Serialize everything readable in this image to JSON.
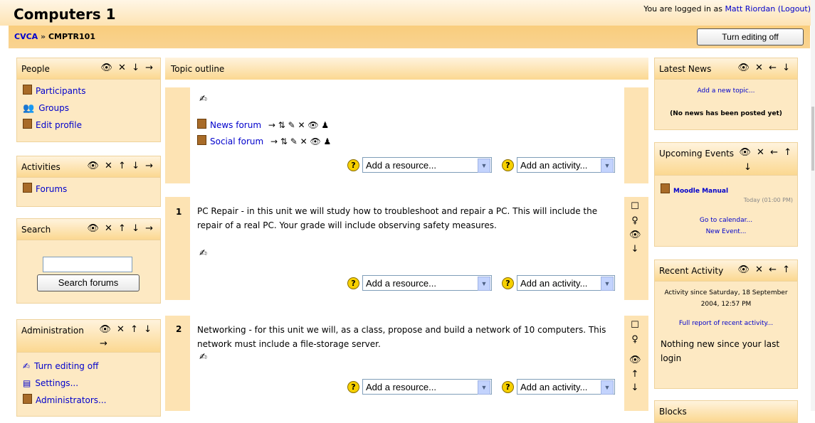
{
  "header": {
    "title": "Computers 1",
    "login_prefix": "You are logged in as",
    "login_user": "Matt Riordan",
    "logout": "(Logout)"
  },
  "navbar": {
    "crumb_home": "CVCA",
    "crumb_sep": "»",
    "crumb_course": "CMPTR101",
    "edit_button": "Turn editing off"
  },
  "left": {
    "people": {
      "title": "People",
      "icons": "👁 ✕ ↓ →",
      "items": [
        "Participants",
        "Groups",
        "Edit profile"
      ]
    },
    "activities": {
      "title": "Activities",
      "icons": "👁 ✕ ↑ ↓ →",
      "items": [
        "Forums"
      ]
    },
    "search": {
      "title": "Search",
      "icons": "👁 ✕ ↑ ↓ →",
      "button": "Search forums",
      "input_value": ""
    },
    "admin": {
      "title": "Administration",
      "icons": "👁 ✕ ↑ ↓",
      "icons2": "→",
      "items": [
        "Turn editing off",
        "Settings...",
        "Administrators..."
      ]
    }
  },
  "main": {
    "title": "Topic outline",
    "topic0": {
      "forums": [
        {
          "name": "News forum",
          "icons": "→ ⇅ ✎ ✕ 👁  ♟"
        },
        {
          "name": "Social forum",
          "icons": "→ ⇅ ✎ ✕ 👁  ♟"
        }
      ]
    },
    "topic1": {
      "number": "1",
      "text": "PC Repair - in this unit we will study how to troubleshoot and repair a PC. This will include the repair of a real PC. Your grade will include observing safety measures."
    },
    "topic2": {
      "number": "2",
      "text": "Networking - for this unit we will, as a class, propose and build a network of 10 computers. This network must include a file-storage server."
    },
    "add_resource": "Add a resource...",
    "add_activity": "Add an activity..."
  },
  "right": {
    "news": {
      "title": "Latest News",
      "icons": "👁 ✕ ← ↓",
      "add": "Add a new topic...",
      "empty": "(No news has been posted yet)"
    },
    "events": {
      "title": "Upcoming Events",
      "icons": "👁 ✕ ← ↑",
      "icons2": "↓",
      "event_name": "Moodle Manual",
      "event_time": "Today (01:00 PM)",
      "calendar": "Go to calendar...",
      "new_event": "New Event..."
    },
    "recent": {
      "title": "Recent Activity",
      "icons": "👁 ✕ ← ↑",
      "since": "Activity since Saturday, 18 September 2004, 12:57 PM",
      "full_report": "Full report of recent activity...",
      "nothing": "Nothing new since your last login"
    },
    "blocks": {
      "title": "Blocks"
    }
  }
}
